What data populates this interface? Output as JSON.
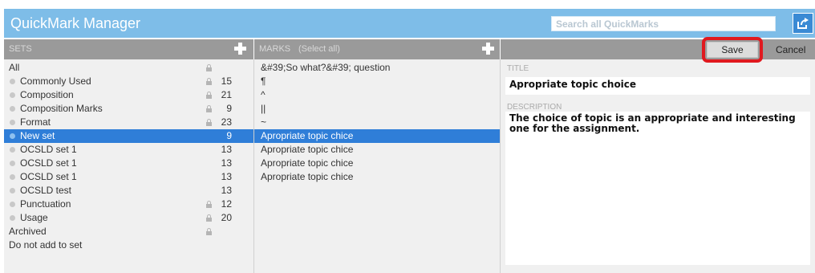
{
  "header": {
    "title": "QuickMark Manager",
    "search_placeholder": "Search all QuickMarks"
  },
  "sets": {
    "header": "SETS",
    "items": [
      {
        "label": "All",
        "count": "",
        "locked": true,
        "dot": false,
        "selected": false
      },
      {
        "label": "Commonly Used",
        "count": "15",
        "locked": true,
        "dot": true,
        "selected": false
      },
      {
        "label": "Composition",
        "count": "21",
        "locked": true,
        "dot": true,
        "selected": false
      },
      {
        "label": "Composition Marks",
        "count": "9",
        "locked": true,
        "dot": true,
        "selected": false
      },
      {
        "label": "Format",
        "count": "23",
        "locked": true,
        "dot": true,
        "selected": false
      },
      {
        "label": "New set",
        "count": "9",
        "locked": false,
        "dot": true,
        "selected": true
      },
      {
        "label": "OCSLD set 1",
        "count": "13",
        "locked": false,
        "dot": true,
        "selected": false
      },
      {
        "label": "OCSLD set 1",
        "count": "13",
        "locked": false,
        "dot": true,
        "selected": false
      },
      {
        "label": "OCSLD set 1",
        "count": "13",
        "locked": false,
        "dot": true,
        "selected": false
      },
      {
        "label": "OCSLD test",
        "count": "13",
        "locked": false,
        "dot": true,
        "selected": false
      },
      {
        "label": "Punctuation",
        "count": "12",
        "locked": true,
        "dot": true,
        "selected": false
      },
      {
        "label": "Usage",
        "count": "20",
        "locked": true,
        "dot": true,
        "selected": false
      },
      {
        "label": "Archived",
        "count": "",
        "locked": true,
        "dot": false,
        "selected": false
      },
      {
        "label": "Do not add to set",
        "count": "",
        "locked": false,
        "dot": false,
        "selected": false
      }
    ]
  },
  "marks": {
    "header": "MARKS",
    "select_all": "(Select all)",
    "items": [
      {
        "label": "&#39;So what?&#39; question",
        "selected": false
      },
      {
        "label": "¶",
        "selected": false
      },
      {
        "label": "^",
        "selected": false
      },
      {
        "label": "||",
        "selected": false
      },
      {
        "label": "~",
        "selected": false
      },
      {
        "label": "Apropriate topic chice",
        "selected": true
      },
      {
        "label": "Apropriate topic chice",
        "selected": false
      },
      {
        "label": "Apropriate topic chice",
        "selected": false
      },
      {
        "label": "Apropriate topic chice",
        "selected": false
      }
    ]
  },
  "detail": {
    "save_label": "Save",
    "cancel_label": "Cancel",
    "title_label": "TITLE",
    "title_value": "Apropriate topic choice",
    "description_label": "DESCRIPTION",
    "description_value": "The choice of topic is an appropriate and interesting one for the assignment."
  },
  "colors": {
    "titlebar": "#7ebde8",
    "selection": "#2f7ed8",
    "highlight": "#e0191f"
  }
}
